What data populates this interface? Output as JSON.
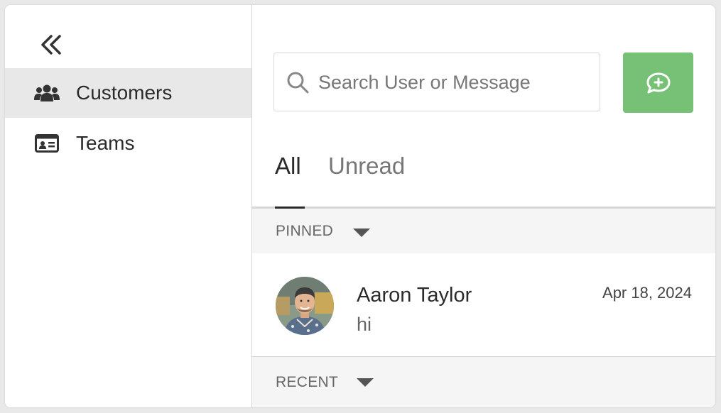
{
  "sidebar": {
    "collapse_icon": "double-chevron-left-icon",
    "items": [
      {
        "label": "Customers",
        "icon": "users-icon",
        "active": true
      },
      {
        "label": "Teams",
        "icon": "id-card-icon",
        "active": false
      }
    ]
  },
  "search": {
    "placeholder": "Search User or Message",
    "value": "",
    "icon": "search-icon"
  },
  "new_chat_button": {
    "icon": "chat-plus-icon",
    "color": "#77c177"
  },
  "tabs": [
    {
      "label": "All",
      "active": true
    },
    {
      "label": "Unread",
      "active": false
    }
  ],
  "sections": {
    "pinned": {
      "label": "PINNED"
    },
    "recent": {
      "label": "RECENT"
    }
  },
  "conversations": [
    {
      "name": "Aaron Taylor",
      "last_message": "hi",
      "date": "Apr 18, 2024",
      "avatar": "avatar-photo"
    }
  ]
}
